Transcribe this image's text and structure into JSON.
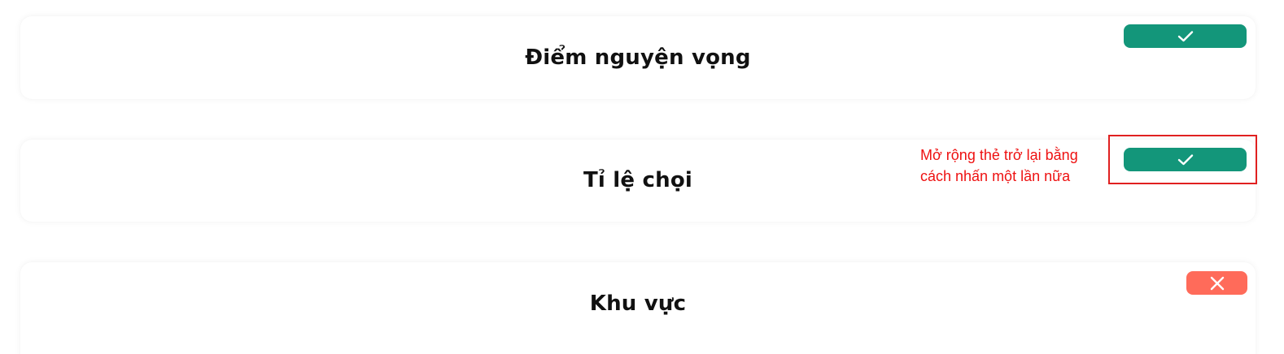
{
  "cards": [
    {
      "title": "Điểm nguyện vọng",
      "toggle": {
        "state": "on",
        "icon": "check-icon",
        "color": "#13967a"
      }
    },
    {
      "title": "Tỉ lệ chọi",
      "toggle": {
        "state": "on",
        "icon": "check-icon",
        "color": "#13967a"
      }
    },
    {
      "title": "Khu vực",
      "toggle": {
        "state": "off",
        "icon": "close-icon",
        "color": "#ff6b5a"
      }
    }
  ],
  "annotation": {
    "text": "Mở rộng thẻ trở lại bằng cách nhấn một lần nữa",
    "color": "#ee1111"
  }
}
